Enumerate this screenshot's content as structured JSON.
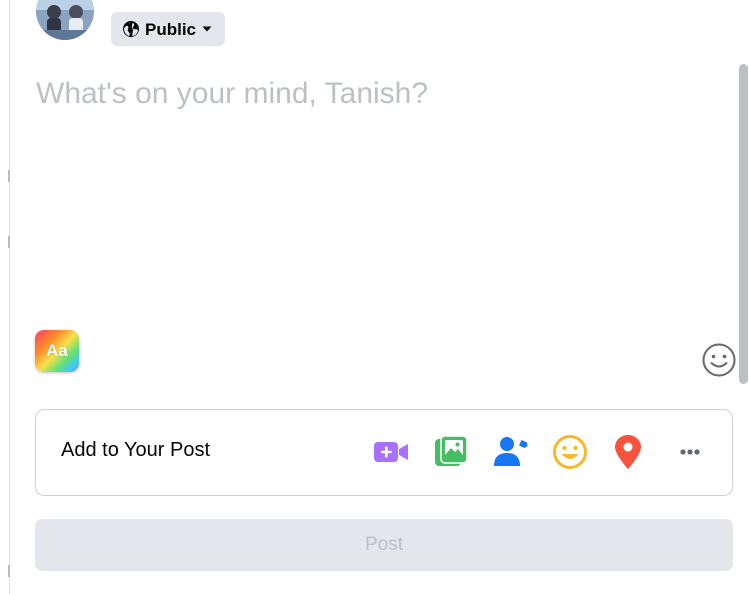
{
  "privacy": {
    "label": "Public",
    "icon": "globe-icon",
    "dropdown_icon": "caret-down-icon"
  },
  "composer": {
    "placeholder": "What's on your mind, Tanish?",
    "value": ""
  },
  "background_picker": {
    "label": "Aa"
  },
  "add_to_post": {
    "label": "Add to Your Post",
    "tools": [
      {
        "name": "live-video",
        "icon": "video-camera-icon",
        "color": "#a970ff"
      },
      {
        "name": "photo-video",
        "icon": "photo-icon",
        "color": "#45bd62"
      },
      {
        "name": "tag-people",
        "icon": "tag-people-icon",
        "color": "#1877f2"
      },
      {
        "name": "feeling-activity",
        "icon": "smiley-icon",
        "color": "#f7b928"
      },
      {
        "name": "check-in",
        "icon": "location-pin-icon",
        "color": "#f5533d"
      },
      {
        "name": "more",
        "icon": "more-dots-icon",
        "color": "#606770"
      }
    ]
  },
  "post_button": {
    "label": "Post"
  },
  "colors": {
    "button_bg": "#e4e6eb",
    "disabled_text": "#bcc0c4",
    "border": "#ced0d4"
  }
}
